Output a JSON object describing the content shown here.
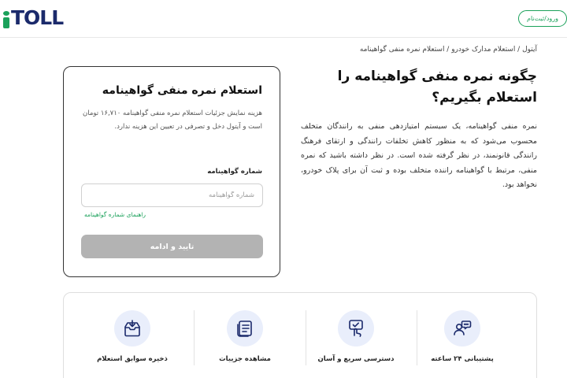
{
  "header": {
    "logo_text": "TOLL",
    "login_label": "ورود/ثبت‌نام"
  },
  "breadcrumb": "آیتول / استعلام مدارک خودرو / استعلام نمره منفی گواهینامه",
  "info": {
    "title": "چگونه نمره منفی گواهینامه را استعلام بگیریم؟",
    "body": "نمره منفی گواهینامه، یک سیستم امتیازدهی منفی به رانندگان متخلف محسوب می‌شود که به منظور کاهش تخلفات رانندگی و ارتقای فرهنگ رانندگی قانونمند، در نظر گرفته شده است. در نظر داشته باشید که نمره منفی، مرتبط با گواهینامه راننده متخلف بوده و ثبت آن برای پلاک خودرو، نخواهد بود."
  },
  "form": {
    "title": "استعلام نمره منفی گواهینامه",
    "description": "هزینه نمایش جزئیات استعلام نمره منفی گواهینامه ۱۶,۷۱۰ تومان است و آیتول دخل و تصرفی در تعیین این هزینه ندارد.",
    "field_label": "شماره گواهینامه",
    "field_placeholder": "شماره گواهینامه",
    "guide_link": "راهنمای شماره گواهینامه",
    "submit_label": "تایید و ادامه"
  },
  "features": [
    {
      "label": "پشتیبانی ۲۴ ساعته",
      "icon": "support-chat-icon"
    },
    {
      "label": "دسترسی سریع و آسان",
      "icon": "touch-tap-icon"
    },
    {
      "label": "مشاهده جزییات",
      "icon": "details-list-icon"
    },
    {
      "label": "ذخیره سوابق استعلام",
      "icon": "save-inbox-icon"
    }
  ],
  "colors": {
    "brand_green": "#1aa15a",
    "brand_navy": "#1b2a6b",
    "icon_bg": "#e9eefb",
    "button_disabled": "#b3b3b3"
  }
}
